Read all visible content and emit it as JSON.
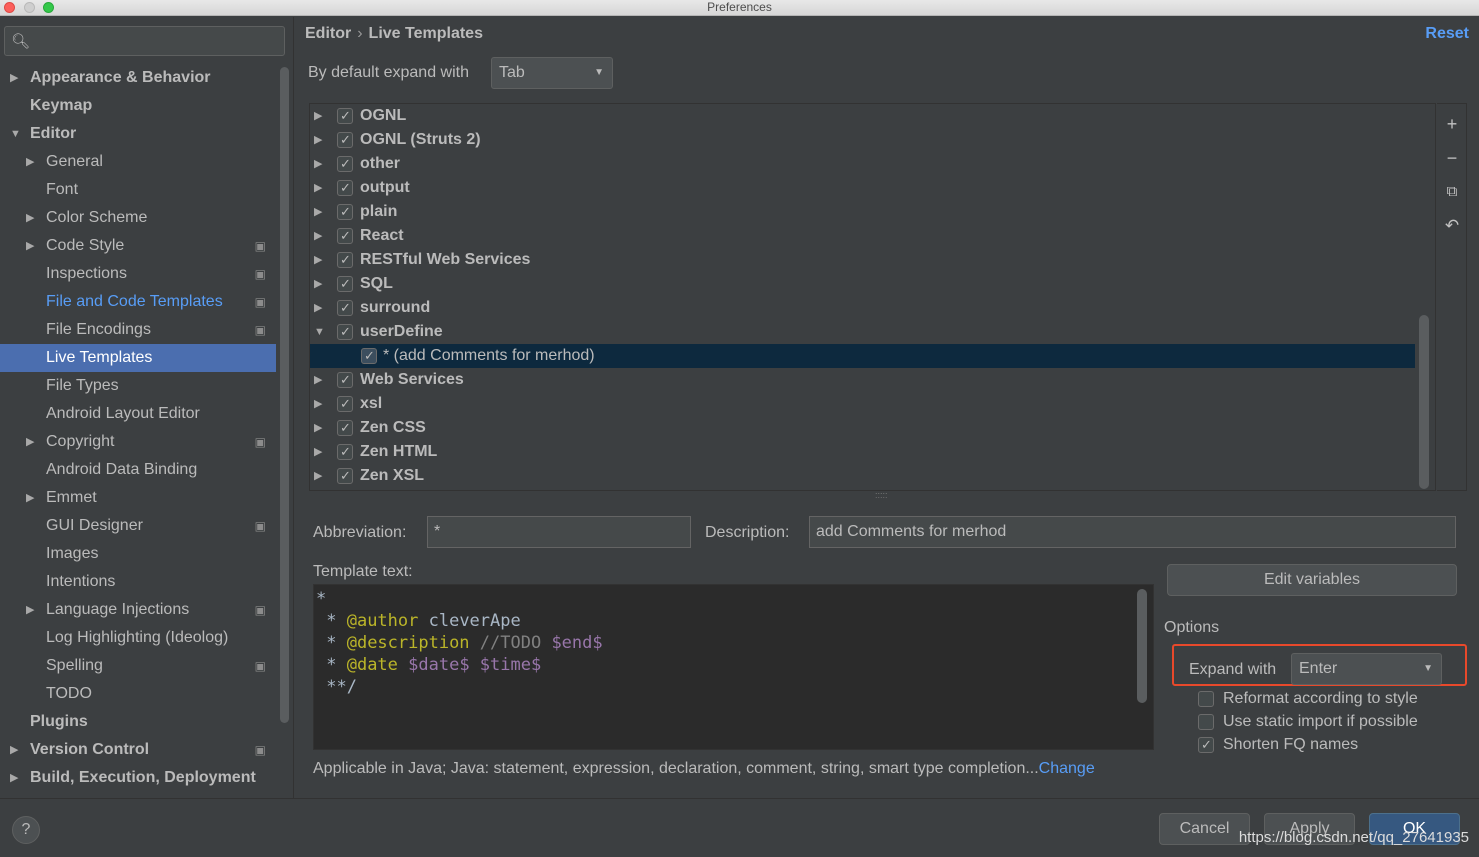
{
  "window": {
    "title": "Preferences"
  },
  "sidebar": {
    "search_placeholder": "",
    "items": [
      {
        "label": "Appearance & Behavior",
        "level": 0,
        "arrow": "▶"
      },
      {
        "label": "Keymap",
        "level": 0,
        "arrow": ""
      },
      {
        "label": "Editor",
        "level": 0,
        "arrow": "▼"
      },
      {
        "label": "General",
        "level": 1,
        "arrow": "▶"
      },
      {
        "label": "Font",
        "level": 1,
        "arrow": ""
      },
      {
        "label": "Color Scheme",
        "level": 1,
        "arrow": "▶"
      },
      {
        "label": "Code Style",
        "level": 1,
        "arrow": "▶",
        "project": true
      },
      {
        "label": "Inspections",
        "level": 1,
        "arrow": "",
        "project": true
      },
      {
        "label": "File and Code Templates",
        "level": 1,
        "arrow": "",
        "project": true,
        "link": true
      },
      {
        "label": "File Encodings",
        "level": 1,
        "arrow": "",
        "project": true
      },
      {
        "label": "Live Templates",
        "level": 1,
        "arrow": "",
        "selected": true
      },
      {
        "label": "File Types",
        "level": 1,
        "arrow": ""
      },
      {
        "label": "Android Layout Editor",
        "level": 1,
        "arrow": ""
      },
      {
        "label": "Copyright",
        "level": 1,
        "arrow": "▶",
        "project": true
      },
      {
        "label": "Android Data Binding",
        "level": 1,
        "arrow": ""
      },
      {
        "label": "Emmet",
        "level": 1,
        "arrow": "▶"
      },
      {
        "label": "GUI Designer",
        "level": 1,
        "arrow": "",
        "project": true
      },
      {
        "label": "Images",
        "level": 1,
        "arrow": ""
      },
      {
        "label": "Intentions",
        "level": 1,
        "arrow": ""
      },
      {
        "label": "Language Injections",
        "level": 1,
        "arrow": "▶",
        "project": true
      },
      {
        "label": "Log Highlighting (Ideolog)",
        "level": 1,
        "arrow": ""
      },
      {
        "label": "Spelling",
        "level": 1,
        "arrow": "",
        "project": true
      },
      {
        "label": "TODO",
        "level": 1,
        "arrow": ""
      },
      {
        "label": "Plugins",
        "level": 0,
        "arrow": ""
      },
      {
        "label": "Version Control",
        "level": 0,
        "arrow": "▶",
        "project": true
      },
      {
        "label": "Build, Execution, Deployment",
        "level": 0,
        "arrow": "▶"
      }
    ]
  },
  "header": {
    "breadcrumb_parent": "Editor",
    "breadcrumb_sep": "›",
    "breadcrumb_current": "Live Templates",
    "reset_label": "Reset"
  },
  "expand_default": {
    "label": "By default expand with",
    "value": "Tab"
  },
  "template_groups": [
    {
      "name": "OGNL",
      "checked": true,
      "expanded": false
    },
    {
      "name": "OGNL (Struts 2)",
      "checked": true,
      "expanded": false
    },
    {
      "name": "other",
      "checked": true,
      "expanded": false
    },
    {
      "name": "output",
      "checked": true,
      "expanded": false
    },
    {
      "name": "plain",
      "checked": true,
      "expanded": false
    },
    {
      "name": "React",
      "checked": true,
      "expanded": false
    },
    {
      "name": "RESTful Web Services",
      "checked": true,
      "expanded": false
    },
    {
      "name": "SQL",
      "checked": true,
      "expanded": false
    },
    {
      "name": "surround",
      "checked": true,
      "expanded": false
    },
    {
      "name": "userDefine",
      "checked": true,
      "expanded": true
    },
    {
      "name": "* (add Comments for merhod)",
      "checked": true,
      "child": true,
      "selected": true
    },
    {
      "name": "Web Services",
      "checked": true,
      "expanded": false
    },
    {
      "name": "xsl",
      "checked": true,
      "expanded": false
    },
    {
      "name": "Zen CSS",
      "checked": true,
      "expanded": false
    },
    {
      "name": "Zen HTML",
      "checked": true,
      "expanded": false
    },
    {
      "name": "Zen XSL",
      "checked": true,
      "expanded": false
    }
  ],
  "toolbar_icons": [
    "add-icon",
    "remove-icon",
    "copy-icon",
    "restore-icon"
  ],
  "form": {
    "abbreviation_label": "Abbreviation:",
    "abbreviation_value": "*",
    "description_label": "Description:",
    "description_value": "add Comments for merhod",
    "template_text_label": "Template text:",
    "edit_variables_label": "Edit variables",
    "options_label": "Options",
    "expand_with_label": "Expand with",
    "expand_with_value": "Enter",
    "reformat_label": "Reformat according to style",
    "reformat_checked": false,
    "static_import_label": "Use static import if possible",
    "static_import_checked": false,
    "shorten_fq_label": "Shorten FQ names",
    "shorten_fq_checked": true,
    "applicable_text": "Applicable in Java; Java: statement, expression, declaration, comment, string, smart type completion...",
    "change_link": "Change"
  },
  "template_text": {
    "line1": "*",
    "line2_prefix": " * ",
    "line2_tag": "@author",
    "line2_rest": " cleverApe",
    "line3_prefix": " * ",
    "line3_tag": "@description",
    "line3_comment": " //TODO ",
    "line3_var": "$end$",
    "line4_prefix": " * ",
    "line4_tag": "@date",
    "line4_var1": " $date$",
    "line4_var2": " $time$",
    "line5": " **/"
  },
  "footer": {
    "help_label": "?",
    "cancel_label": "Cancel",
    "apply_label": "Apply",
    "ok_label": "OK",
    "watermark": "https://blog.csdn.net/qq_27641935"
  },
  "colors": {
    "accent": "#589df6",
    "selection": "#4b6eaf",
    "highlight_box": "#e8492b",
    "background": "#3c3f41"
  }
}
